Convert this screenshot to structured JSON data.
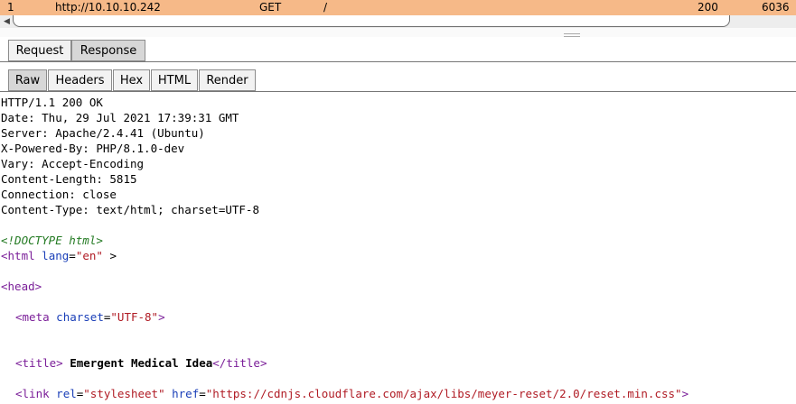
{
  "history": {
    "number": "1",
    "host": "http://10.10.10.242",
    "method": "GET",
    "url": "/",
    "status": "200",
    "length": "6036"
  },
  "panel_tabs": [
    "Request",
    "Response"
  ],
  "view_tabs": [
    "Raw",
    "Headers",
    "Hex",
    "HTML",
    "Render"
  ],
  "response": {
    "headers": [
      "HTTP/1.1 200 OK",
      "Date: Thu, 29 Jul 2021 17:39:31 GMT",
      "Server: Apache/2.4.41 (Ubuntu)",
      "X-Powered-By: PHP/8.1.0-dev",
      "Vary: Accept-Encoding",
      "Content-Length: 5815",
      "Connection: close",
      "Content-Type: text/html; charset=UTF-8"
    ],
    "body": {
      "doctype": "<!DOCTYPE html>",
      "html_open": "<html",
      "html_lang_attr": "lang",
      "html_lang_value": "\"en\"",
      "html_close_bracket": " >",
      "head_open": "<head>",
      "meta_open": "<meta",
      "meta_attr": "charset",
      "meta_value": "\"UTF-8\"",
      "meta_close": ">",
      "title_open": "<title>",
      "title_text": " Emergent Medical Idea",
      "title_close": "</title>",
      "link_open": "<link",
      "link_rel_attr": "rel",
      "link_rel_value": "\"stylesheet\"",
      "link_href_attr": "href",
      "link_href_value": "\"https://cdnjs.cloudflare.com/ajax/libs/meyer-reset/2.0/reset.min.css\"",
      "link_close": ">",
      "equals": "="
    }
  },
  "colors": {
    "highlight_row": "#f6b988",
    "tag": "#7b1f99",
    "attribute": "#1a3fb8",
    "value": "#b01b24",
    "doctype": "#237a22"
  }
}
